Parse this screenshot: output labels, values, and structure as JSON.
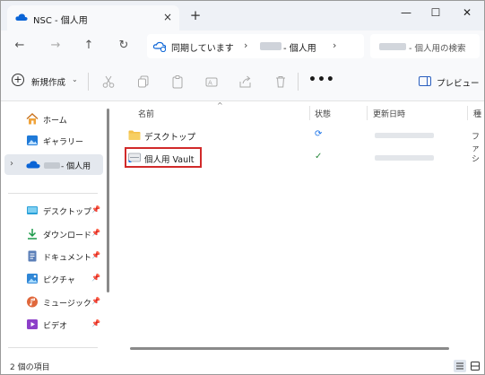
{
  "window": {
    "tab_title": "NSC - 個人用",
    "tab_close": "×",
    "new_tab": "+",
    "controls": {
      "minimize": "—",
      "maximize": "☐",
      "close": "✕"
    }
  },
  "nav": {
    "back": "←",
    "forward": "→",
    "up": "↑",
    "refresh": "↻",
    "address": {
      "sync_status": "同期しています",
      "sep": "›",
      "location": "- 個人用"
    },
    "search_placeholder": "- 個人用の検索"
  },
  "command_bar": {
    "new_label": "新規作成",
    "new_caret": "⌄",
    "more": "•••",
    "preview_label": "プレビュー"
  },
  "sidebar": {
    "items": [
      {
        "label": "ホーム",
        "icon": "home-icon"
      },
      {
        "label": "ギャラリー",
        "icon": "gallery-icon"
      },
      {
        "label": "- 個人用",
        "icon": "onedrive-cloud-icon",
        "expand": "›"
      },
      {
        "label": "デスクトップ",
        "icon": "desktop-folder-icon",
        "pinned": true
      },
      {
        "label": "ダウンロード",
        "icon": "download-icon",
        "pinned": true
      },
      {
        "label": "ドキュメント",
        "icon": "document-icon",
        "pinned": true
      },
      {
        "label": "ピクチャ",
        "icon": "pictures-icon",
        "pinned": true
      },
      {
        "label": "ミュージック",
        "icon": "music-icon",
        "pinned": true
      },
      {
        "label": "ビデオ",
        "icon": "video-icon",
        "pinned": true
      }
    ],
    "pin_glyph": "📌"
  },
  "list": {
    "columns": [
      "名前",
      "状態",
      "更新日時",
      "種"
    ],
    "sort_caret": "^",
    "rows": [
      {
        "name": "デスクトップ",
        "icon": "folder-icon",
        "status": "sync-icon",
        "status_glyph": "⟳",
        "type": "ファ"
      },
      {
        "name": "個人用 Vault",
        "icon": "vault-icon",
        "status": "synced-icon",
        "status_glyph": "✓",
        "type": "シ"
      }
    ]
  },
  "status_bar": {
    "item_count": "2 個の項目"
  },
  "colors": {
    "accent": "#0067c0",
    "highlight_box": "#d12a2a",
    "folder": "#f4c14a",
    "sync_blue": "#1a73e8",
    "synced_green": "#2b8a3e"
  }
}
